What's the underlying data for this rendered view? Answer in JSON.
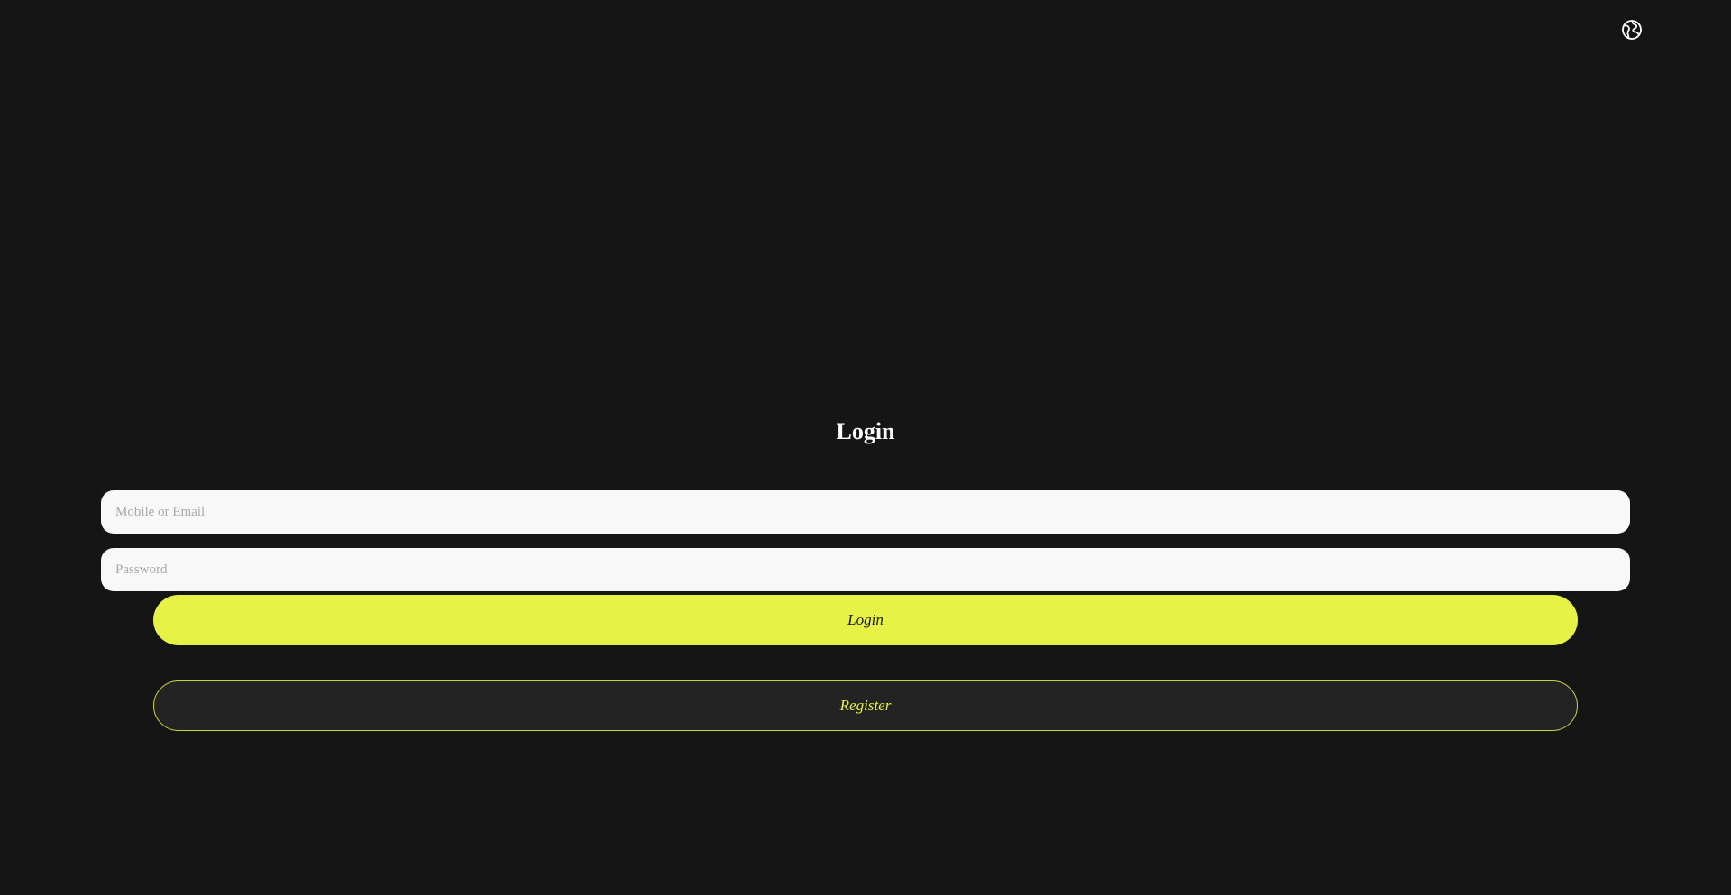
{
  "header": {
    "language_icon": "globe-language-icon"
  },
  "login_form": {
    "title": "Login",
    "email_placeholder": "Mobile or Email",
    "password_placeholder": "Password",
    "login_label": "Login",
    "register_label": "Register"
  },
  "colors": {
    "background": "#151515",
    "accent": "#e6f245",
    "input_background": "#f8f8f8",
    "register_background": "#232323"
  }
}
